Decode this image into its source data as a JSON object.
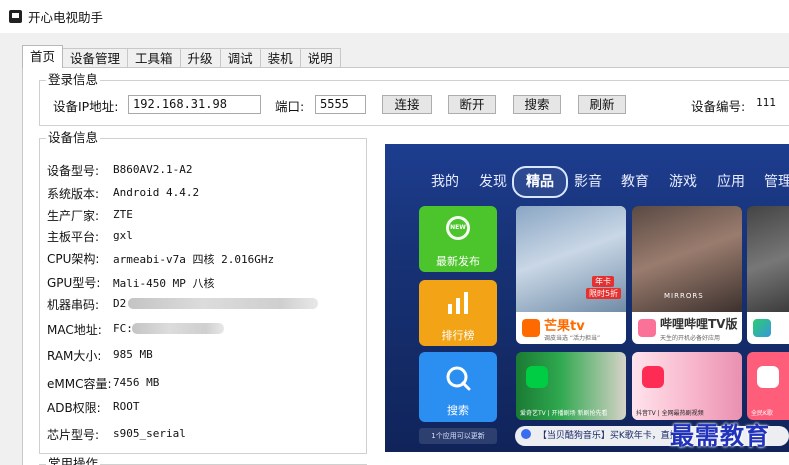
{
  "window": {
    "title": "开心电视助手"
  },
  "tabs": [
    "首页",
    "设备管理",
    "工具箱",
    "升级",
    "调试",
    "装机",
    "说明"
  ],
  "login": {
    "legend": "登录信息",
    "ip_label": "设备IP地址:",
    "ip_value": "192.168.31.98",
    "port_label": "端口:",
    "port_value": "5555",
    "connect": "连接",
    "disconnect": "断开",
    "search": "搜索",
    "refresh": "刷新",
    "device_no_label": "设备编号:",
    "device_no_value": "111"
  },
  "device_info": {
    "legend": "设备信息",
    "rows": [
      {
        "label": "设备型号:",
        "value": "B860AV2.1-A2"
      },
      {
        "label": "系统版本:",
        "value": "Android 4.4.2"
      },
      {
        "label": "生产厂家:",
        "value": "ZTE"
      },
      {
        "label": "主板平台:",
        "value": "gxl"
      },
      {
        "label": "CPU架构:",
        "value": "armeabi-v7a 四核 2.016GHz"
      },
      {
        "label": "GPU型号:",
        "value": "Mali-450 MP 八核"
      },
      {
        "label": "机器串码:",
        "value": "D2"
      },
      {
        "label": "MAC地址:",
        "value": "FC:"
      },
      {
        "label": "RAM大小:",
        "value": "985 MB"
      },
      {
        "label": "eMMC容量:",
        "value": "7456 MB"
      },
      {
        "label": "ADB权限:",
        "value": "ROOT"
      },
      {
        "label": "芯片型号:",
        "value": "s905_serial"
      }
    ]
  },
  "next_group": {
    "legend": "常用操作"
  },
  "tv": {
    "nav": [
      "我的",
      "发现",
      "精品",
      "影音",
      "教育",
      "游戏",
      "应用",
      "管理"
    ],
    "selected_nav": "精品",
    "left_tiles": [
      {
        "label": "最新发布",
        "badge": "NEW",
        "color": "#49c22a"
      },
      {
        "label": "排行榜",
        "color": "#f2a215"
      },
      {
        "label": "搜索",
        "color": "#2a8ef0"
      }
    ],
    "apps_link": "1个应用可以更新",
    "cards": [
      {
        "brand": "芒果tv",
        "sub": "调皮当选 “活力担当”",
        "badge_top": "年卡",
        "badge_bottom": "限时5折"
      },
      {
        "brand": "哔哩哔哩TV版",
        "sub": "天生的开机必备好应用",
        "poster": "MIRRORS"
      },
      {
        "brand": "爱奇艺TV",
        "sub": "爱奇艺TV | 开播剧场 新剧抢先看"
      },
      {
        "brand": "抖音TV",
        "sub": "抖音TV | 全网最热剧视频"
      },
      {
        "brand": "全民K歌",
        "sub": ""
      }
    ],
    "ticker": "【当贝酷狗音乐】买K歌年卡，直播…"
  },
  "watermark": "最需教育"
}
